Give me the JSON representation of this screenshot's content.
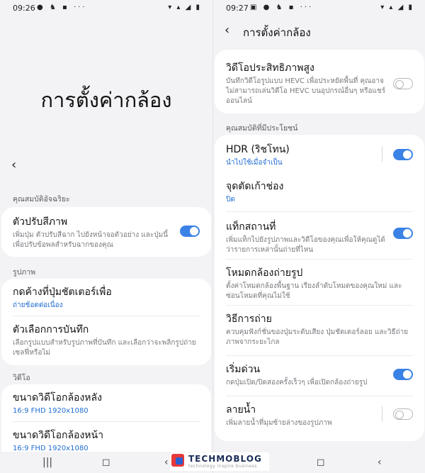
{
  "left": {
    "status": {
      "time": "09:26",
      "notif_icons": "● ♞ ▪ ···",
      "sys_icons": "▾ ▴ ◢ ▮"
    },
    "page_title": "การตั้งค่ากล้อง",
    "sections": {
      "smart": "คุณสมบัติอัจฉริยะ",
      "photos": "รูปภาพ",
      "video": "วิดีโอ"
    },
    "items": {
      "scene_optimizer": {
        "title": "ตัวปรับสีภาพ",
        "desc": "เพิ่มปุ่ม ตัวปรับสีฉาก ไปยังหน้าจอตัวอย่าง และปุ่มนี้เพื่อปรับข้อพลสำหรับฉากของคุณ",
        "on": true
      },
      "hold_shutter": {
        "title": "กดค้างที่ปุ่มชัตเตอร์เพื่อ",
        "value": "ถ่ายช้อตต่อเนื่อง"
      },
      "save_options": {
        "title": "ตัวเลือกการบันทึก",
        "desc": "เลือกรูปแบบสำหรับรูปภาพที่บันทึก และเลือกว่าจะพลิกรูปถ่ายเซลฟี่หรือไม่"
      },
      "rear_video_size": {
        "title": "ขนาดวิดีโอกล้องหลัง",
        "value": "16:9 FHD 1920x1080"
      },
      "front_video_size": {
        "title": "ขนาดวิดีโอกล้องหน้า",
        "value": "16:9 FHD 1920x1080"
      }
    }
  },
  "right": {
    "status": {
      "time": "09:27",
      "notif_icons": "▣ ● ♞ ▪ ···",
      "sys_icons": "▾ ▴ ◢ ▮"
    },
    "header_title": "การตั้งค่ากล้อง",
    "sections": {
      "useful": "คุณสมบัติที่มีประโยชน์"
    },
    "items": {
      "hevc": {
        "title": "วิดีโอประสิทธิภาพสูง",
        "desc": "บันทึกวิดีโอรูปแบบ HEVC เพื่อประหยัดพื้นที่ คุณอาจไม่สามารถเล่นวิดีโอ HEVC บนอุปกรณ์อื่นๆ หรือแชร์ออนไลน์",
        "on": false
      },
      "hdr": {
        "title": "HDR (ริชโทน)",
        "value": "นำไปใช้เมื่อจำเป็น",
        "on": true
      },
      "grid": {
        "title": "จุดตัดเก้าช่อง",
        "value": "ปิด"
      },
      "location": {
        "title": "แท็กสถานที่",
        "desc": "เพิ่มแท็กไปยังรูปภาพและวิดีโอของคุณเพื่อให้คุณดูได้ว่ารายการเหล่านั้นถ่ายที่ไหน",
        "on": true
      },
      "camera_modes": {
        "title": "โหมดกล้องถ่ายรูป",
        "desc": "ตั้งค่าโหมดกล้องพื้นฐาน เรียงลำดับโหมดของคุณใหม่ และซ่อนโหมดที่คุณไม่ใช้"
      },
      "shooting_methods": {
        "title": "วิธีการถ่าย",
        "desc": "ควบคุมฟังก์ชั่นของปุ่มระดับเสียง ปุ่มชัตเตอร์ลอย และวิธีถ่ายภาพจากระยะไกล"
      },
      "quick_launch": {
        "title": "เริ่มด่วน",
        "desc": "กดปุ่มเปิด/ปิดสองครั้งเร็วๆ เพื่อเปิดกล้องถ่ายรูป",
        "on": true
      },
      "watermark": {
        "title": "ลายน้ำ",
        "desc": "เพิ่มลายน้ำที่มุมซ้ายล่างของรูปภาพ",
        "on": false
      }
    }
  },
  "navbar": {
    "recents": "|||",
    "home": "◻",
    "back": "‹"
  },
  "watermark": {
    "name": "TECHMOBLOG",
    "tagline": "technology inspire business"
  }
}
